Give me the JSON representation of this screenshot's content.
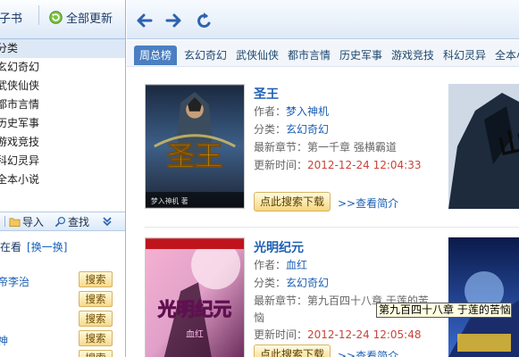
{
  "left_pane": {
    "ebook_tab": "电子书",
    "update_all": "全部更新",
    "categories": [
      "分类",
      "玄幻奇幻",
      "武侠仙侠",
      "都市言情",
      "历史军事",
      "游戏竞技",
      "科幻灵异",
      "全本小说"
    ],
    "toolbar": {
      "import": "导入",
      "search": "查找"
    },
    "reading": {
      "title": "正在看",
      "swap": "[换一换]"
    },
    "reading_items": [
      {
        "name": "帝李治",
        "button": "搜索"
      },
      {
        "name": "",
        "button": "搜索"
      },
      {
        "name": "",
        "button": "搜索"
      },
      {
        "name": "神",
        "button": "搜索"
      },
      {
        "name": "",
        "button": "搜索"
      }
    ]
  },
  "tabs": [
    "周总榜",
    "玄幻奇幻",
    "武侠仙侠",
    "都市言情",
    "历史军事",
    "游戏竞技",
    "科幻灵异",
    "全本小"
  ],
  "books": [
    {
      "title": "圣王",
      "author_label": "作者：",
      "author": "梦入神机",
      "category_label": "分类：",
      "category": "玄幻奇幻",
      "latest_label": "最新章节：",
      "latest": "第一千章 强横霸道",
      "updated_label": "更新时间：",
      "updated": "2012-12-24 12:04:33",
      "download": "点此搜索下载",
      "intro": ">>查看简介",
      "cover_text": "圣王",
      "cover_author": "梦入神机 著"
    },
    {
      "title": "光明纪元",
      "author_label": "作者：",
      "author": "血红",
      "category_label": "分类：",
      "category": "玄幻奇幻",
      "latest_label": "最新章节：",
      "latest": "第九百四十八章 于莲的苦",
      "latest_cont": "恼",
      "updated_label": "更新时间：",
      "updated": "2012-12-24 12:05:48",
      "download": "点此搜索下载",
      "intro": ">>查看简介",
      "cover_text": "光明纪元",
      "cover_author": "血红"
    }
  ],
  "tooltip": "第九百四十八章 于莲的苦恼"
}
